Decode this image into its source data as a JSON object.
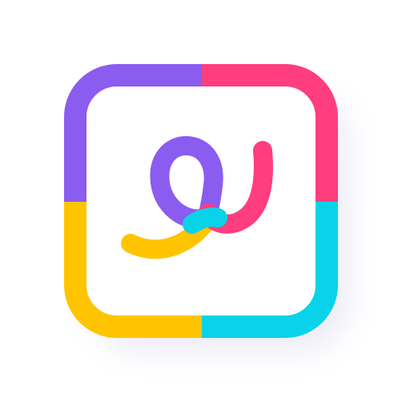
{
  "logo": {
    "name": "app-icon",
    "colors": {
      "purple": "#8B5CF0",
      "pink": "#FF3D7F",
      "yellow": "#FFC400",
      "cyan": "#08D3E8",
      "background": "#FFFFFF",
      "shadow": "#9A8FD0"
    }
  }
}
